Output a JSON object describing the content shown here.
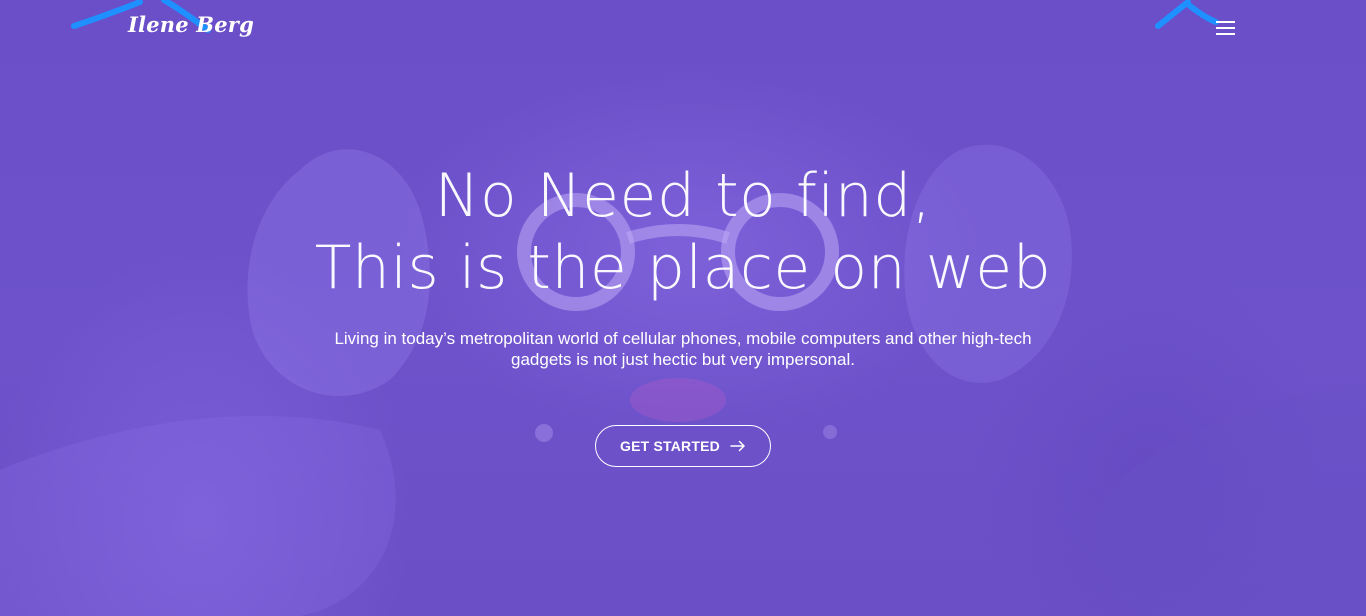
{
  "header": {
    "logo_text": "Ilene Berg"
  },
  "hero": {
    "headline_line1": "No Need to find,",
    "headline_line2": "This is the place on web",
    "subtext": "Living in today’s metropolitan world of cellular phones, mobile computers and other high-tech gadgets is not just hectic but very impersonal.",
    "cta_label": "GET STARTED"
  },
  "icons": {
    "menu": "hamburger-menu-icon",
    "cta": "arrow-right-icon"
  },
  "colors": {
    "overlay": "#6a4fc7",
    "accent_swoosh": "#1e90ff",
    "text": "#ffffff"
  }
}
